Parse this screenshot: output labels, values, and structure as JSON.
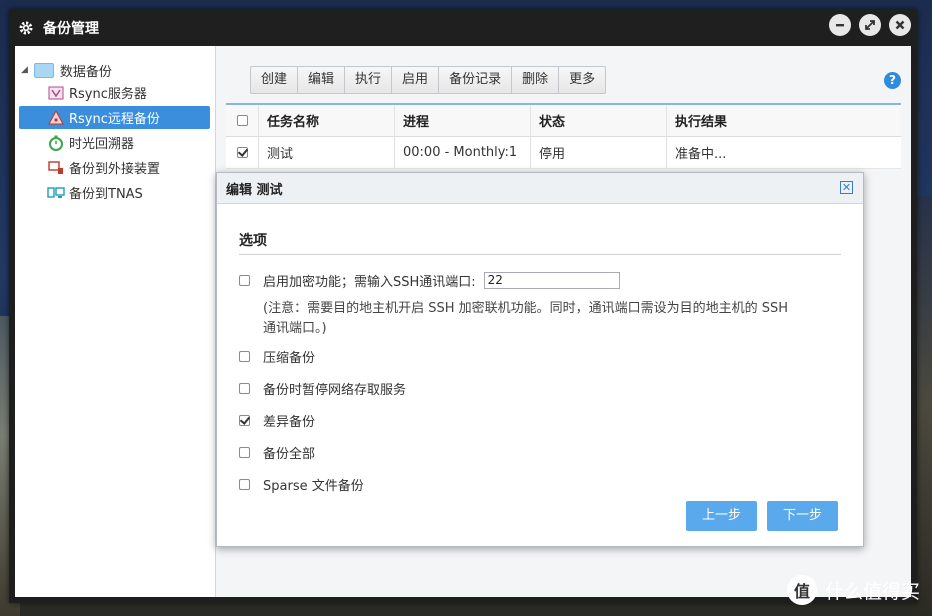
{
  "window": {
    "title": "备份管理"
  },
  "sidebar": {
    "root_label": "数据备份",
    "items": [
      {
        "label": "Rsync服务器"
      },
      {
        "label": "Rsync远程备份"
      },
      {
        "label": "时光回溯器"
      },
      {
        "label": "备份到外接装置"
      },
      {
        "label": "备份到TNAS"
      }
    ]
  },
  "toolbar": {
    "buttons": [
      "创建",
      "编辑",
      "执行",
      "启用",
      "备份记录",
      "删除",
      "更多"
    ]
  },
  "table": {
    "headers": [
      "任务名称",
      "进程",
      "状态",
      "执行结果"
    ],
    "rows": [
      {
        "name": "测试",
        "schedule": "00:00 - Monthly:1",
        "status": "停用",
        "result": "准备中...",
        "checked": true
      }
    ]
  },
  "dialog": {
    "title": "编辑 测试",
    "section": "选项",
    "options": [
      {
        "label": "启用加密功能；需输入SSH通讯端口:",
        "checked": false
      },
      {
        "label": "压缩备份",
        "checked": false
      },
      {
        "label": "备份时暂停网络存取服务",
        "checked": false
      },
      {
        "label": "差异备份",
        "checked": true
      },
      {
        "label": "备份全部",
        "checked": false
      },
      {
        "label": "Sparse 文件备份",
        "checked": false
      }
    ],
    "ssh_port": "22",
    "note_line1": "(注意：需要目的地主机开启 SSH 加密联机功能。同时，通讯端口需设为目的地主机的 SSH",
    "note_line2": "通讯端口。)",
    "prev_label": "上一步",
    "next_label": "下一步"
  },
  "watermark": {
    "logo_text": "值",
    "text": "什么值得买"
  },
  "colors": {
    "accent": "#3b8edc",
    "button_blue": "#5aa9ec",
    "titlebar": "#1f1f1f"
  }
}
